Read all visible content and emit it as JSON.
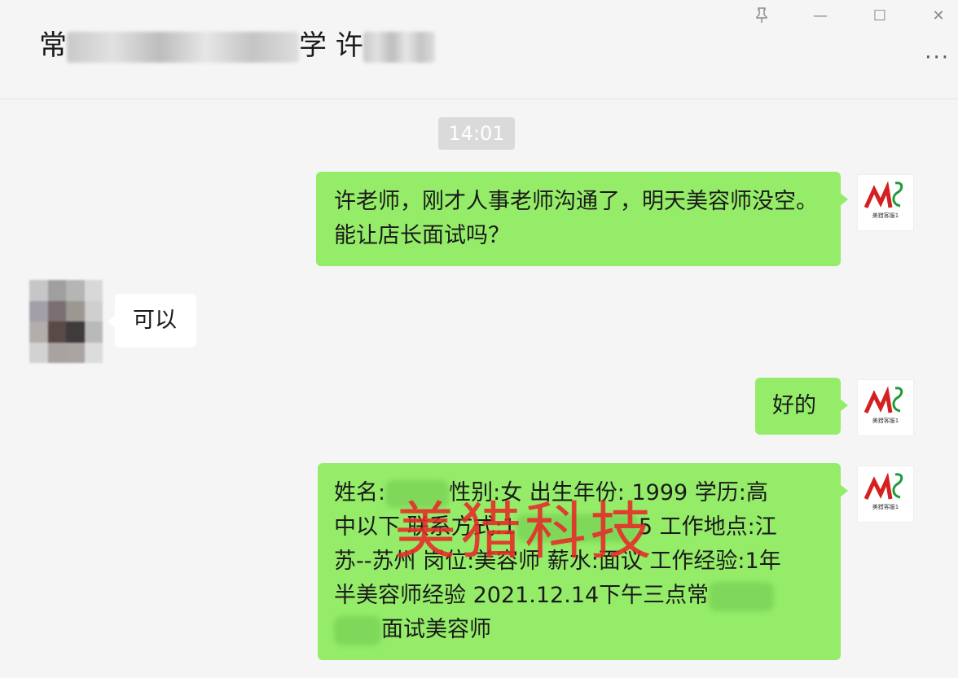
{
  "header": {
    "title_start": "常",
    "title_mid": "学 许",
    "more_label": "···"
  },
  "window": {
    "pin_icon": "pin-icon",
    "minimize": "—",
    "maximize": "☐",
    "close": "✕"
  },
  "chat": {
    "timestamp": "14:01",
    "messages": [
      {
        "sender": "me",
        "text": "许老师，刚才人事老师沟通了，明天美容师没空。能让店长面试吗？"
      },
      {
        "sender": "other",
        "text": "可以"
      },
      {
        "sender": "me",
        "text": "好的"
      },
      {
        "sender": "me",
        "line1_a": "姓名:",
        "line1_b": "性别:女 出生年份: 1999 学历:高",
        "line2_a": "中以下 联系方式:1",
        "line2_b": "5 工作地点:江",
        "line3": "苏--苏州 岗位:美容师 薪水:面议 工作经验:1年",
        "line4_a": "半美容师经验 2021.12.14下午三点常",
        "line5_b": "面试美容师"
      }
    ]
  },
  "avatar_me": {
    "logo_text": "ML",
    "caption": "美猎客服1"
  },
  "watermark": "美猎科技",
  "colors": {
    "bubble_me": "#95ec69",
    "bubble_other": "#ffffff",
    "watermark": "#e82828"
  }
}
